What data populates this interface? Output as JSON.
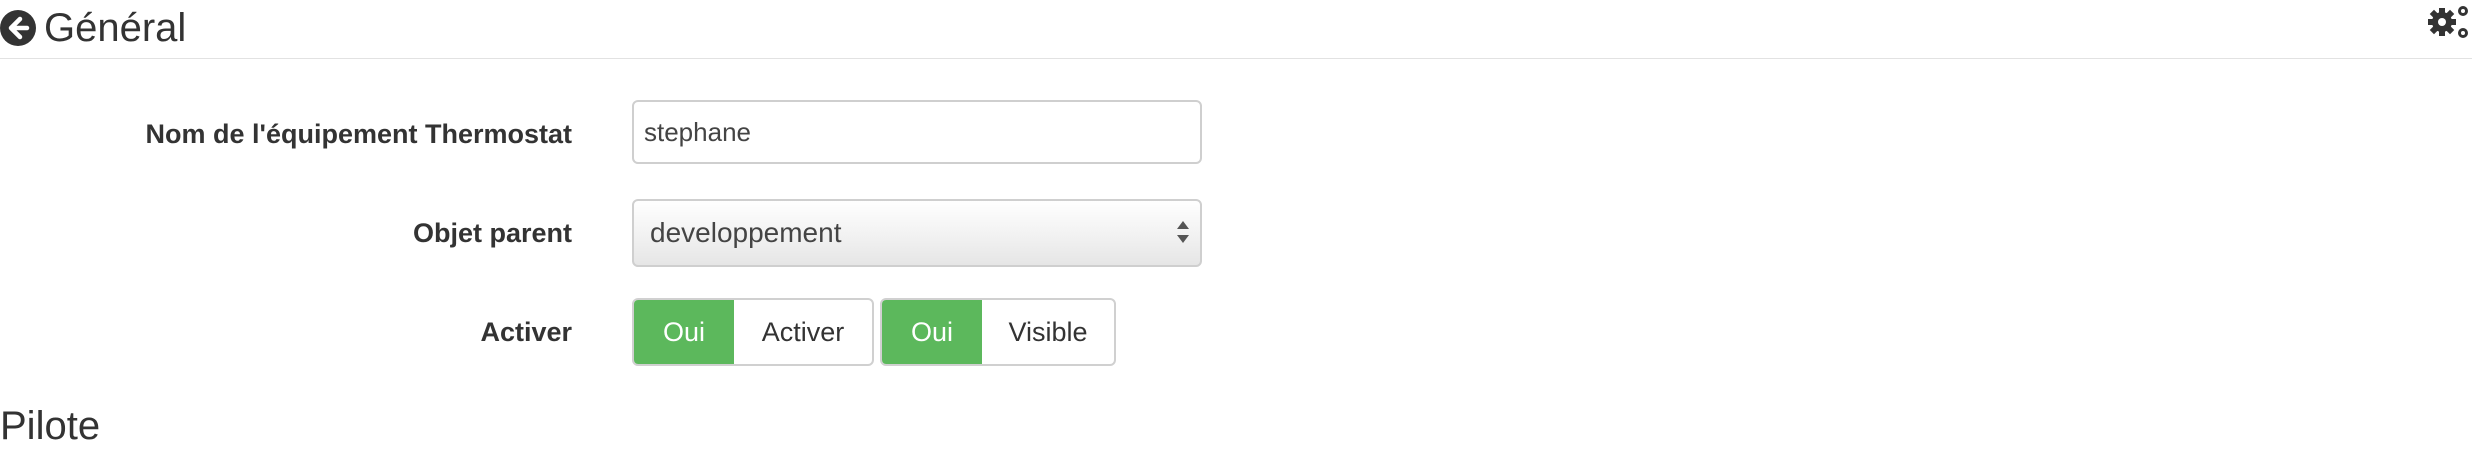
{
  "header": {
    "title": "Général",
    "back_icon": "arrow-circle-left-icon",
    "config_icon": "gears-icon"
  },
  "form": {
    "name": {
      "label": "Nom de l'équipement Thermostat",
      "value": "stephane"
    },
    "parent": {
      "label": "Objet parent",
      "selected": "developpement"
    },
    "activer": {
      "label": "Activer",
      "enable_toggle": {
        "state": "Oui",
        "label": "Activer"
      },
      "visible_toggle": {
        "state": "Oui",
        "label": "Visible"
      }
    }
  },
  "next_section": {
    "title": "Pilote"
  },
  "colors": {
    "toggle_on": "#5cb85c",
    "text": "#333333",
    "border": "#cfcfcf"
  }
}
